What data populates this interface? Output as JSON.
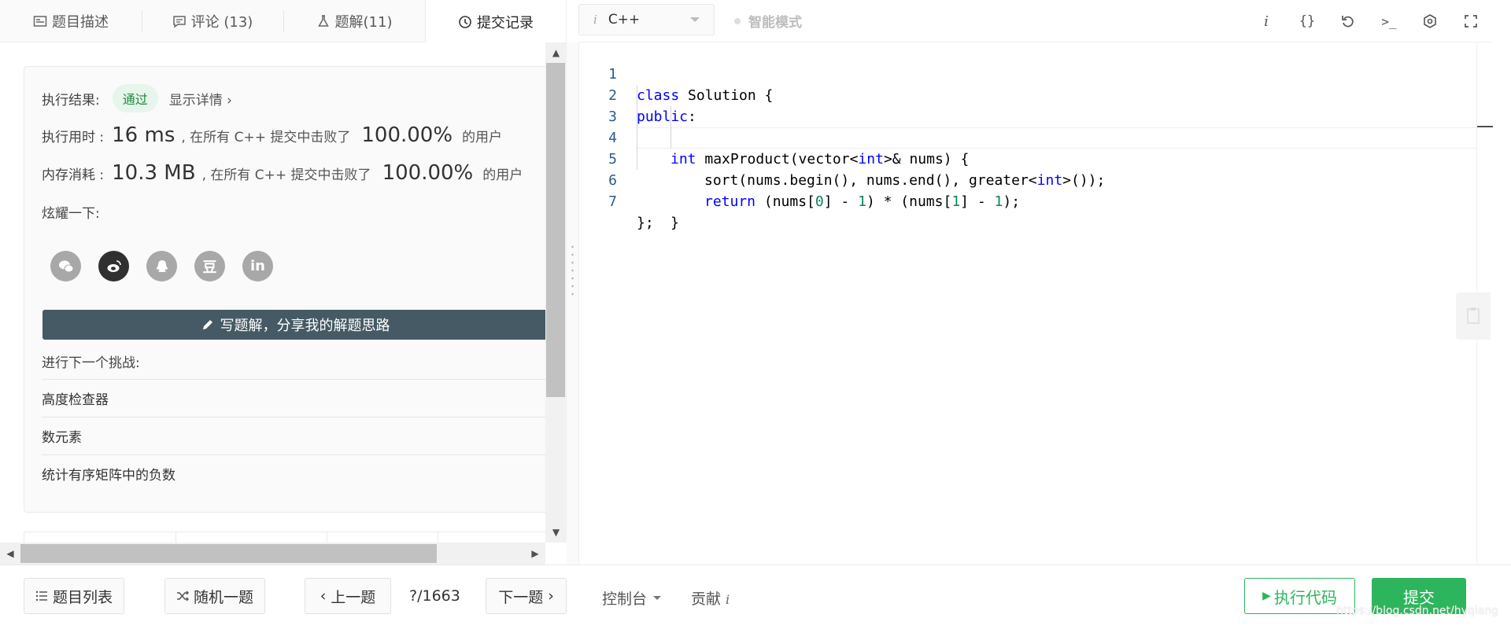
{
  "tabs": [
    {
      "label": "题目描述"
    },
    {
      "label": "评论 (13)"
    },
    {
      "label": "题解(11)"
    },
    {
      "label": "提交记录"
    }
  ],
  "result": {
    "status_label": "执行结果:",
    "status": "通过",
    "detail_link": "显示详情 ›",
    "time_label": "执行用时 :",
    "time_value": "16 ms",
    "time_mid": ", 在所有 C++ 提交中击败了",
    "time_pct": "100.00%",
    "time_suffix": "的用户",
    "mem_label": "内存消耗 :",
    "mem_value": "10.3 MB",
    "mem_mid": ", 在所有 C++ 提交中击败了",
    "mem_pct": "100.00%",
    "mem_suffix": "的用户",
    "share_label": "炫耀一下:",
    "share_icons": [
      "wechat-icon",
      "weibo-icon",
      "qq-icon",
      "douban-icon",
      "linkedin-icon"
    ],
    "douban_glyph": "豆",
    "linkedin_glyph": "in",
    "write_button": "写题解，分享我的解题思路",
    "next_title": "进行下一个挑战:",
    "challenges": [
      "高度检查器",
      "数元素",
      "统计有序矩阵中的负数"
    ]
  },
  "editor": {
    "language": "C++",
    "lang_prefix": "i",
    "smart_mode": "智能模式",
    "toolbar_icons": [
      "info-icon",
      "braces-icon",
      "reset-icon",
      "terminal-icon",
      "settings-icon",
      "fullscreen-icon"
    ],
    "info_glyph": "i",
    "braces_glyph": "{}",
    "terminal_glyph": ">_",
    "line_numbers": [
      "1",
      "2",
      "3",
      "4",
      "5",
      "6",
      "7"
    ],
    "code": {
      "l1_kw": "class",
      "l1_rest": " Solution {",
      "l2_kw": "public",
      "l2_rest": ":",
      "l3_kw": "int",
      "l3_a": " maxProduct(vector<",
      "l3_kw2": "int",
      "l3_b": ">& nums) {",
      "l4_a": "sort(nums.begin(), nums.end(), greater<",
      "l4_kw": "int",
      "l4_b": ">());",
      "l5_kw": "return",
      "l5_a": " (nums[",
      "l5_n1": "0",
      "l5_b": "] - ",
      "l5_n2": "1",
      "l5_c": ") * (nums[",
      "l5_n3": "1",
      "l5_d": "] - ",
      "l5_n4": "1",
      "l5_e": ");",
      "l6": "}",
      "l7": "};"
    }
  },
  "bottom": {
    "problem_list": "题目列表",
    "random": "随机一题",
    "prev": "上一题",
    "counter": "?/1663",
    "next": "下一题",
    "console": "控制台",
    "contribute": "贡献",
    "contribute_i": "i",
    "run": "执行代码",
    "submit": "提交",
    "watermark": "https://blog.csdn.net/hyqiang"
  },
  "colors": {
    "accent_green": "#2db55d",
    "pass_badge_bg": "#e6f6ec",
    "write_button_bg": "#455a64",
    "keyword_blue": "#0000ff",
    "number_green": "#098658"
  }
}
